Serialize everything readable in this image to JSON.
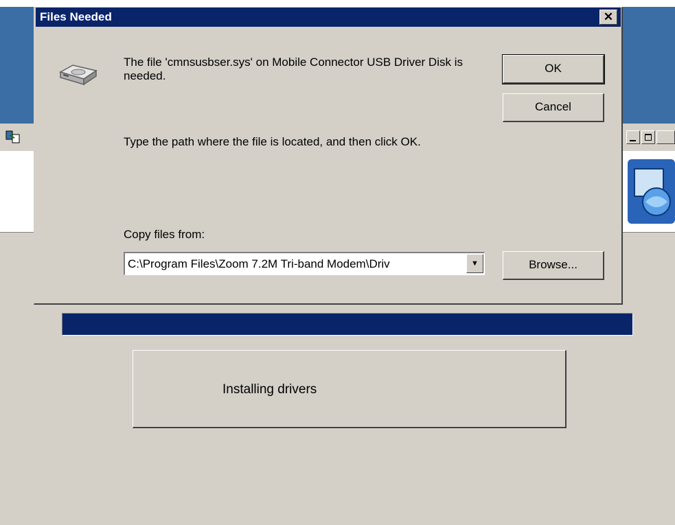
{
  "dialog": {
    "title": "Files Needed",
    "close_label": "✕",
    "message_1": "The file 'cmnsusbser.sys' on Mobile Connector USB Driver Disk is needed.",
    "message_2": "Type the path where the file is located, and then click OK.",
    "copy_from_label": "Copy files from:",
    "copy_from_value": "C:\\Program Files\\Zoom 7.2M Tri-band Modem\\Driv",
    "ok_label": "OK",
    "cancel_label": "Cancel",
    "browse_label": "Browse..."
  },
  "installer": {
    "status_text": "Installing drivers",
    "progress": 1.0
  },
  "icons": {
    "disk": "disk-drive-icon",
    "dropdown": "chevron-down-icon",
    "app": "installer-app-icon",
    "logo": "globe-window-logo-icon"
  },
  "colors": {
    "desktop_blue": "#3a6ea5",
    "title_bar": "#0a246a",
    "face": "#d4d0c8"
  }
}
